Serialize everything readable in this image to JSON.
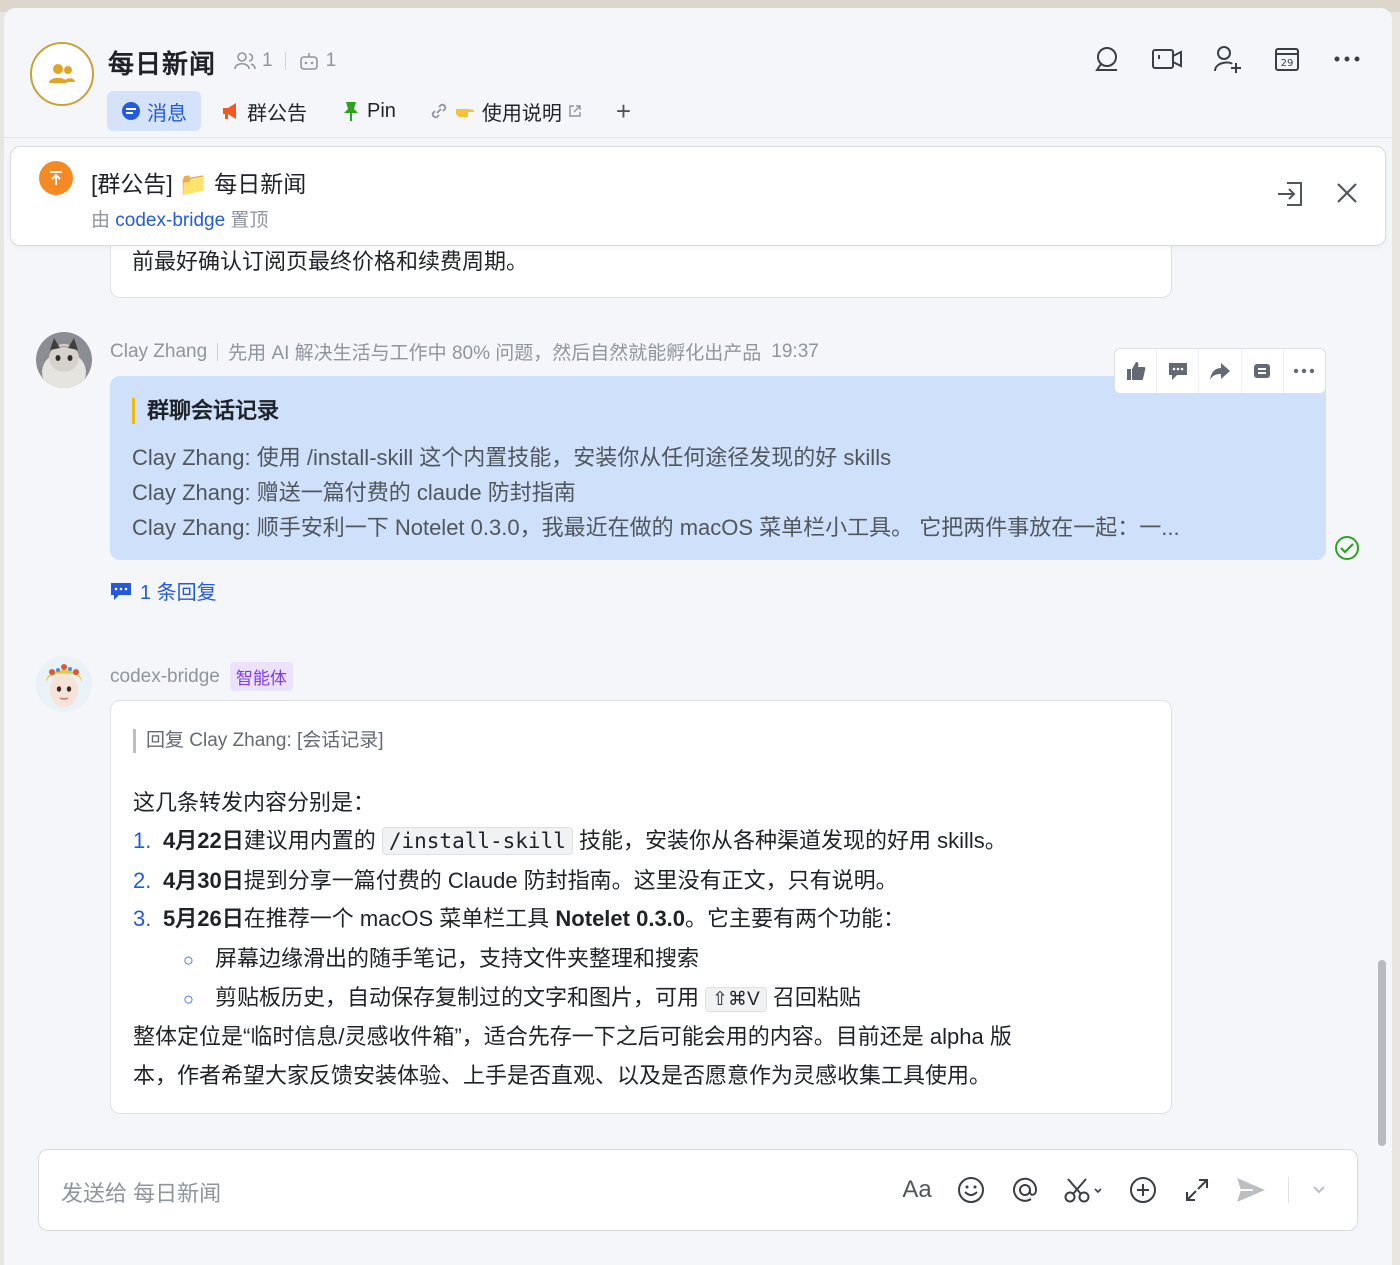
{
  "header": {
    "title": "每日新闻",
    "members_count": "1",
    "bots_count": "1",
    "tabs": [
      {
        "label": "消息"
      },
      {
        "label": "群公告"
      },
      {
        "label": "Pin"
      },
      {
        "label": "使用说明"
      }
    ]
  },
  "pinned_notice": {
    "title": "[群公告] 📁 每日新闻",
    "by_prefix": "由",
    "by_user": "codex-bridge",
    "by_suffix": "置顶"
  },
  "messages": [
    {
      "partial_text": "前最好确认订阅页最终价格和续费周期。"
    },
    {
      "sender": "Clay Zhang",
      "signature": "先用 AI 解决生活与工作中 80% 问题，然后自然就能孵化出产品",
      "time": "19:37",
      "card_title": "群聊会话记录",
      "card_lines": [
        "Clay Zhang: 使用 /install-skill 这个内置技能，安装你从任何途径发现的好 skills",
        "Clay Zhang: 赠送一篇付费的 claude 防封指南",
        "Clay Zhang: 顺手安利一下 Notelet 0.3.0，我最近在做的 macOS 菜单栏小工具。 它把两件事放在一起：一..."
      ],
      "reply_count_label": "1 条回复"
    },
    {
      "sender": "codex-bridge",
      "badge": "智能体",
      "quote": "回复 Clay Zhang: [会话记录]",
      "intro": "这几条转发内容分别是：",
      "items": [
        {
          "num": "1.",
          "date": "4月22日",
          "pre": "建议用内置的",
          "code": "/install-skill",
          "post": "技能，安装你从各种渠道发现的好用 skills。"
        },
        {
          "num": "2.",
          "date": "4月30日",
          "pre": "提到分享一篇付费的 Claude 防封指南。这里没有正文，只有说明。"
        },
        {
          "num": "3.",
          "date": "5月26日",
          "pre": "在推荐一个 macOS 菜单栏工具",
          "bold": "Notelet 0.3.0",
          "post": "。它主要有两个功能："
        }
      ],
      "subitems": [
        {
          "text": "屏幕边缘滑出的随手笔记，支持文件夹整理和搜索"
        },
        {
          "pre": "剪贴板历史，自动保存复制过的文字和图片，可用",
          "kbd": "⇧⌘V",
          "post": "召回粘贴"
        }
      ],
      "outro_1": "整体定位是“临时信息/灵感收件箱”，适合先存一下之后可能会用的内容。目前还是 alpha 版",
      "outro_2": "本，作者希望大家反馈安装体验、上手是否直观、以及是否愿意作为灵感收集工具使用。"
    }
  ],
  "composer": {
    "placeholder": "发送给 每日新闻",
    "format_label": "Aa"
  }
}
